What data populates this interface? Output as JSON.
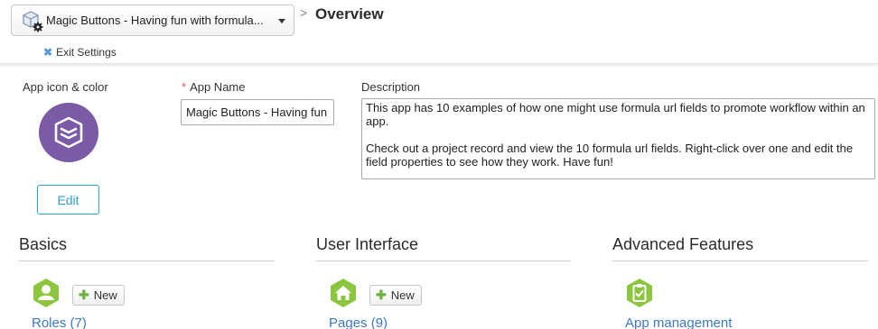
{
  "header": {
    "app_selector_label": "Magic Buttons - Having fun with formula...",
    "breadcrumb_separator": ">",
    "page_title": "Overview",
    "exit_settings": "Exit Settings"
  },
  "form": {
    "app_icon_label": "App icon & color",
    "icon_color": "#7b5aa6",
    "edit_button": "Edit",
    "app_name_required_mark": "*",
    "app_name_label": "App Name",
    "app_name_value": "Magic Buttons - Having fun",
    "description_label": "Description",
    "description_paragraphs": [
      "This app has 10 examples of how one might use formula url fields to promote workflow within an app.",
      "Check out a project record and view the 10 formula url fields.  Right-click over one and edit the field properties to see how they work.  Have fun!"
    ]
  },
  "sections": {
    "basics": {
      "title": "Basics",
      "new_button": "New",
      "link": "Roles (7)",
      "icon": "user-icon"
    },
    "user_interface": {
      "title": "User Interface",
      "new_button": "New",
      "link": "Pages (9)",
      "icon": "home-icon"
    },
    "advanced": {
      "title": "Advanced Features",
      "link": "App management",
      "icon": "clipboard-check-icon"
    }
  },
  "colors": {
    "accent_green": "#8cc63f",
    "link_blue": "#3a78c9",
    "edit_blue": "#2a9fd8"
  }
}
